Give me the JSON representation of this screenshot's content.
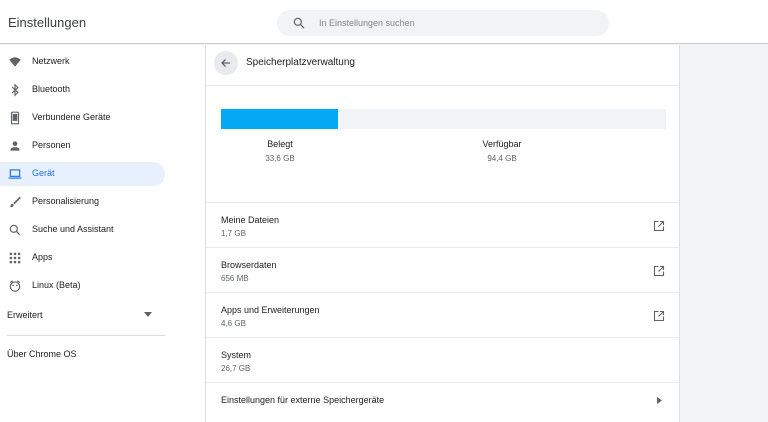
{
  "header": {
    "title": "Einstellungen",
    "search_placeholder": "In Einstellungen suchen"
  },
  "sidebar": {
    "items": [
      {
        "label": "Netzwerk",
        "icon": "wifi-icon"
      },
      {
        "label": "Bluetooth",
        "icon": "bluetooth-icon"
      },
      {
        "label": "Verbundene Geräte",
        "icon": "phone-icon"
      },
      {
        "label": "Personen",
        "icon": "person-icon"
      },
      {
        "label": "Gerät",
        "icon": "laptop-icon",
        "selected": true
      },
      {
        "label": "Personalisierung",
        "icon": "brush-icon"
      },
      {
        "label": "Suche und Assistant",
        "icon": "search-icon"
      },
      {
        "label": "Apps",
        "icon": "apps-grid-icon"
      },
      {
        "label": "Linux (Beta)",
        "icon": "linux-penguin-icon"
      }
    ],
    "advanced_label": "Erweitert",
    "about_label": "Über Chrome OS"
  },
  "main": {
    "title": "Speicherplatzverwaltung",
    "storage": {
      "used_fraction": 0.263,
      "used_label": "Belegt",
      "used_value": "33,6 GB",
      "available_label": "Verfügbar",
      "available_value": "94,4 GB"
    },
    "rows": [
      {
        "title": "Meine Dateien",
        "value": "1,7 GB",
        "action": "external-link-icon"
      },
      {
        "title": "Browserdaten",
        "value": "656 MB",
        "action": "external-link-icon"
      },
      {
        "title": "Apps und Erweiterungen",
        "value": "4,6 GB",
        "action": "external-link-icon"
      },
      {
        "title": "System",
        "value": "26,7 GB"
      },
      {
        "title": "Einstellungen für externe Speichergeräte",
        "action": "arrow-right-icon"
      }
    ]
  },
  "colors": {
    "accent": "#1a73e8",
    "storage_fill": "#03a9f4",
    "selected_bg": "#e8f0fe",
    "icon": "#5f6368"
  }
}
